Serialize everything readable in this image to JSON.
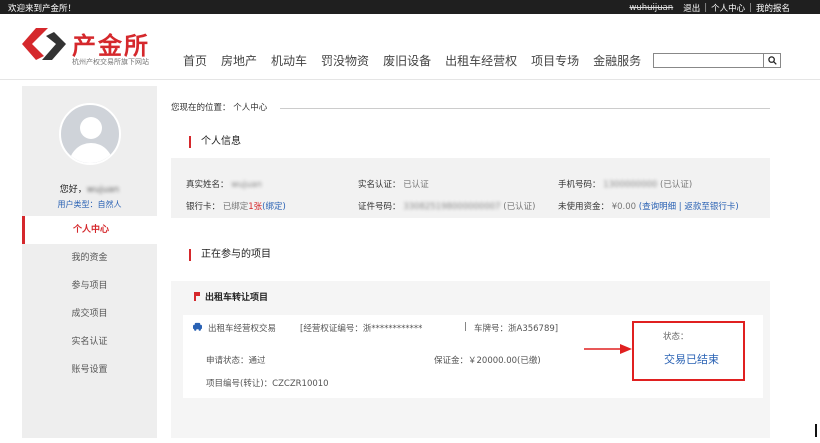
{
  "topbar": {
    "welcome": "欢迎来到产金所！",
    "username": "wuhuijuan",
    "logout": "退出",
    "sep1": "|",
    "personal_center": "个人中心",
    "sep2": "|",
    "my_report": "我的报名"
  },
  "logo": {
    "name": "产金所",
    "subtitle": "杭州产权交易所旗下网站"
  },
  "nav": [
    "首页",
    "房地产",
    "机动车",
    "罚没物资",
    "废旧设备",
    "出租车经营权",
    "项目专场",
    "金融服务"
  ],
  "search": {
    "placeholder": "",
    "button_icon": "search-icon"
  },
  "sidebar": {
    "greeting": "您好，",
    "greeting_name": "wujuan",
    "user_type": "用户类型：自然人",
    "menu": [
      "个人中心",
      "我的资金",
      "参与项目",
      "成交项目",
      "实名认证",
      "账号设置"
    ]
  },
  "breadcrumb": "您现在的位置： 个人中心",
  "personal_info": {
    "title": "个人信息",
    "real_name_label": "真实姓名：",
    "real_name_value": "wujuan",
    "realname_auth_label": "实名认证：",
    "realname_auth_value": "已认证",
    "phone_label": "手机号码：",
    "phone_value": "1300000000",
    "phone_status": "(已认证)",
    "bank_label": "银行卡：",
    "bank_value_pre": "已绑定",
    "bank_count": "1张",
    "bank_bind": "(绑定)",
    "id_label": "证件号码：",
    "id_value": "330825198000000007",
    "id_status": "(已认证)",
    "unused_label": "未使用资金：",
    "unused_value": "¥0.00",
    "unused_links": "(查询明细 | 返款至银行卡)"
  },
  "projects": {
    "title": "正在参与的项目",
    "category": "出租车转让项目",
    "card": {
      "name": "出租车经营权交易",
      "license": "[经营权证编号：浙************",
      "divider": "|",
      "plate": "车牌号：浙A356789]",
      "apply_status": "申请状态：通过",
      "deposit": "保证金：￥20000.00(已缴)",
      "project_no": "项目编号(转让)：CZCZR10010",
      "status_label": "状态：",
      "status_value": "交易已结束"
    }
  },
  "colors": {
    "brand_red": "#d5282c",
    "link_blue": "#2a62b4",
    "highlight_box": "#e02020"
  }
}
